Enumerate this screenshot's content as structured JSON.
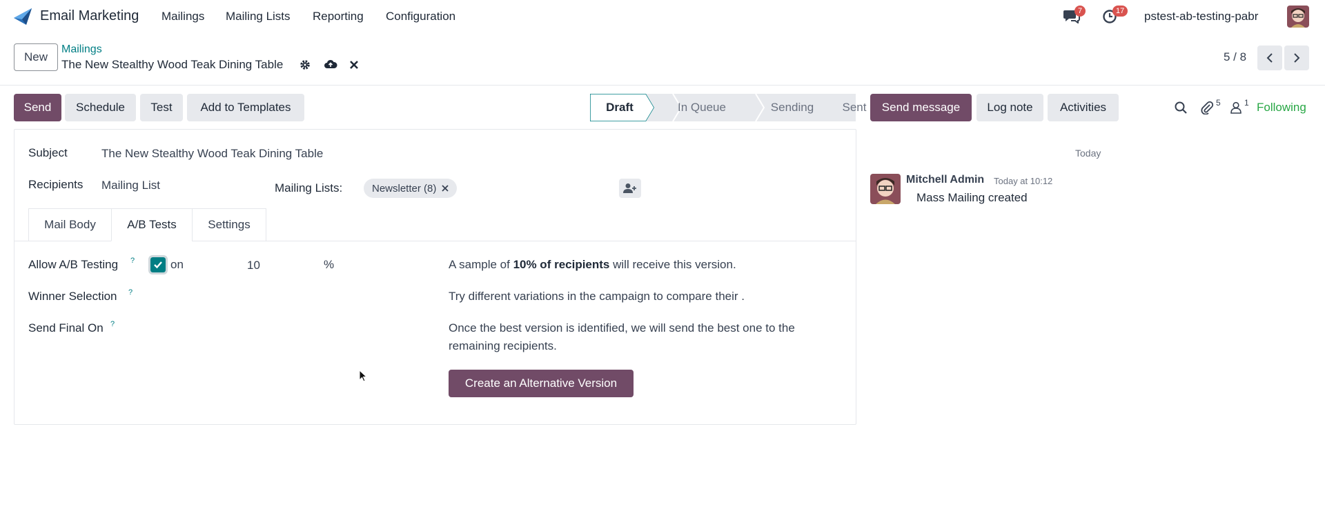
{
  "navbar": {
    "app_name": "Email Marketing",
    "menu": [
      "Mailings",
      "Mailing Lists",
      "Reporting",
      "Configuration"
    ],
    "messages_count": "7",
    "activities_count": "17",
    "user_name": "pstest-ab-testing-pabr"
  },
  "control_panel": {
    "new_label": "New",
    "breadcrumb": "Mailings",
    "record_title": "The New Stealthy Wood Teak Dining Table",
    "pager": "5 / 8"
  },
  "actions": {
    "send": "Send",
    "schedule": "Schedule",
    "test": "Test",
    "add_to_templates": "Add to Templates"
  },
  "status": {
    "stages": [
      "Draft",
      "In Queue",
      "Sending",
      "Sent"
    ],
    "current": "Draft"
  },
  "chatter": {
    "send_message": "Send message",
    "log_note": "Log note",
    "activities": "Activities",
    "attachments_count": "5",
    "followers_count": "1",
    "following": "Following",
    "date_separator": "Today",
    "message": {
      "author": "Mitchell Admin",
      "time": "Today at 10:12",
      "body": "Mass Mailing created"
    }
  },
  "form": {
    "subject_label": "Subject",
    "subject_value": "The New Stealthy Wood Teak Dining Table",
    "recipients_label": "Recipients",
    "recipients_value": "Mailing List",
    "mailing_lists_label": "Mailing Lists:",
    "mailing_list_tag": "Newsletter (8)",
    "tabs": [
      "Mail Body",
      "A/B Tests",
      "Settings"
    ],
    "active_tab": "A/B Tests",
    "ab": {
      "allow_label": "Allow A/B Testing",
      "help_mark": "?",
      "checkbox_text": "on",
      "percent_value": "10",
      "percent_unit": "%",
      "sample_prefix": "A sample of ",
      "sample_bold": "10% of recipients",
      "sample_suffix": " will receive this version.",
      "winner_label": "Winner Selection",
      "winner_text": "Try different variations in the campaign to compare their .",
      "send_final_label": "Send Final On",
      "final_text_line1": "Once the best version is identified, we will send the best one to the",
      "final_text_line2": "remaining recipients.",
      "create_button": "Create an Alternative Version"
    }
  },
  "colors": {
    "primary": "#714b67",
    "link": "#017e84",
    "badge": "#d9534f",
    "following": "#28a745"
  }
}
